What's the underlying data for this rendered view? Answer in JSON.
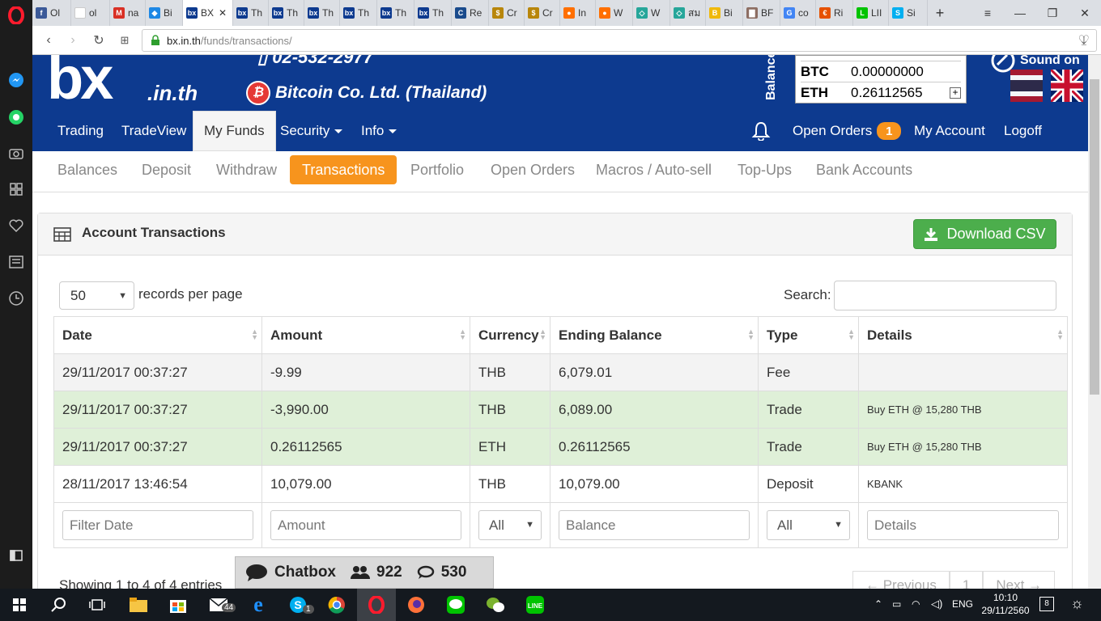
{
  "browser": {
    "tabs": [
      {
        "label": "Ol",
        "color": "#3b5998",
        "glyph": "f"
      },
      {
        "label": "ol",
        "color": "#ffffff",
        "glyph": ""
      },
      {
        "label": "na",
        "color": "#d93025",
        "glyph": "M"
      },
      {
        "label": "Bi",
        "color": "#1e88e5",
        "glyph": "◆"
      },
      {
        "label": "BX",
        "color": "#0d3a8f",
        "glyph": "bx",
        "active": true
      },
      {
        "label": "Th",
        "color": "#0d3a8f",
        "glyph": "bx"
      },
      {
        "label": "Th",
        "color": "#0d3a8f",
        "glyph": "bx"
      },
      {
        "label": "Th",
        "color": "#0d3a8f",
        "glyph": "bx"
      },
      {
        "label": "Th",
        "color": "#0d3a8f",
        "glyph": "bx"
      },
      {
        "label": "Th",
        "color": "#0d3a8f",
        "glyph": "bx"
      },
      {
        "label": "Th",
        "color": "#0d3a8f",
        "glyph": "bx"
      },
      {
        "label": "Re",
        "color": "#1a4b8c",
        "glyph": "C"
      },
      {
        "label": "Cr",
        "color": "#b8860b",
        "glyph": "$"
      },
      {
        "label": "Cr",
        "color": "#b8860b",
        "glyph": "$"
      },
      {
        "label": "In",
        "color": "#ff6f00",
        "glyph": "●"
      },
      {
        "label": "W",
        "color": "#ff6f00",
        "glyph": "●"
      },
      {
        "label": "W",
        "color": "#26a69a",
        "glyph": "◇"
      },
      {
        "label": "สม",
        "color": "#26a69a",
        "glyph": "◇"
      },
      {
        "label": "Bi",
        "color": "#f0b90b",
        "glyph": "B"
      },
      {
        "label": "BF",
        "color": "#8d6e63",
        "glyph": "▇"
      },
      {
        "label": "co",
        "color": "#4285f4",
        "glyph": "G"
      },
      {
        "label": "Ri",
        "color": "#e65100",
        "glyph": "€"
      },
      {
        "label": "LII",
        "color": "#00c300",
        "glyph": "L"
      },
      {
        "label": "Si",
        "color": "#00aff0",
        "glyph": "S"
      }
    ],
    "new_tab": "+",
    "url_host": "bx.in.th",
    "url_path": "/funds/transactions/"
  },
  "site": {
    "logo": "bx",
    "logo_sub": ".in.th",
    "phone": "02-532-2977",
    "company": "Bitcoin Co. Ltd. (Thailand)",
    "balance_label": "Balance",
    "balances": [
      {
        "currency": "BTC",
        "amount": "0.00000000"
      },
      {
        "currency": "ETH",
        "amount": "0.26112565"
      }
    ],
    "sound": "Sound on"
  },
  "main_nav": {
    "trading": "Trading",
    "tradeview": "TradeView",
    "my_funds": "My Funds",
    "security": "Security",
    "info": "Info",
    "open_orders": "Open Orders",
    "open_orders_count": "1",
    "my_account": "My Account",
    "logoff": "Logoff"
  },
  "sub_nav": {
    "balances": "Balances",
    "deposit": "Deposit",
    "withdraw": "Withdraw",
    "transactions": "Transactions",
    "portfolio": "Portfolio",
    "open_orders": "Open Orders",
    "macros": "Macros / Auto-sell",
    "topups": "Top-Ups",
    "bank_accounts": "Bank Accounts"
  },
  "panel": {
    "title": "Account Transactions",
    "download_csv": "Download CSV",
    "per_page_value": "50",
    "per_page_label": "records per page",
    "search_label": "Search:",
    "search_value": ""
  },
  "table": {
    "headers": [
      "Date",
      "Amount",
      "Currency",
      "Ending Balance",
      "Type",
      "Details"
    ],
    "rows": [
      {
        "date": "29/11/2017 00:37:27",
        "amount": "-9.99",
        "currency": "THB",
        "balance": "6,079.01",
        "type": "Fee",
        "details": ""
      },
      {
        "date": "29/11/2017 00:37:27",
        "amount": "-3,990.00",
        "currency": "THB",
        "balance": "6,089.00",
        "type": "Trade",
        "details": "Buy ETH @ 15,280 THB"
      },
      {
        "date": "29/11/2017 00:37:27",
        "amount": "0.26112565",
        "currency": "ETH",
        "balance": "0.26112565",
        "type": "Trade",
        "details": "Buy ETH @ 15,280 THB"
      },
      {
        "date": "28/11/2017 13:46:54",
        "amount": "10,079.00",
        "currency": "THB",
        "balance": "10,079.00",
        "type": "Deposit",
        "details": "KBANK"
      }
    ],
    "filters": {
      "date_placeholder": "Filter Date",
      "amount_placeholder": "Amount",
      "currency_value": "All",
      "balance_placeholder": "Balance",
      "type_value": "All",
      "details_placeholder": "Details"
    }
  },
  "footer": {
    "showing": "Showing 1 to 4 of 4 entries",
    "previous": "← Previous",
    "page": "1",
    "next": "Next →"
  },
  "chatbox": {
    "label": "Chatbox",
    "users": "922",
    "messages": "530"
  },
  "taskbar": {
    "mail_badge": "44",
    "skype_badge": "1",
    "lang": "ENG",
    "time": "10:10",
    "date": "29/11/2560",
    "notifications": "8"
  },
  "colors": {
    "brand_blue": "#0d3a8f",
    "accent_orange": "#f7941d",
    "csv_green": "#4cae4c",
    "trade_row": "#dff0d8"
  }
}
